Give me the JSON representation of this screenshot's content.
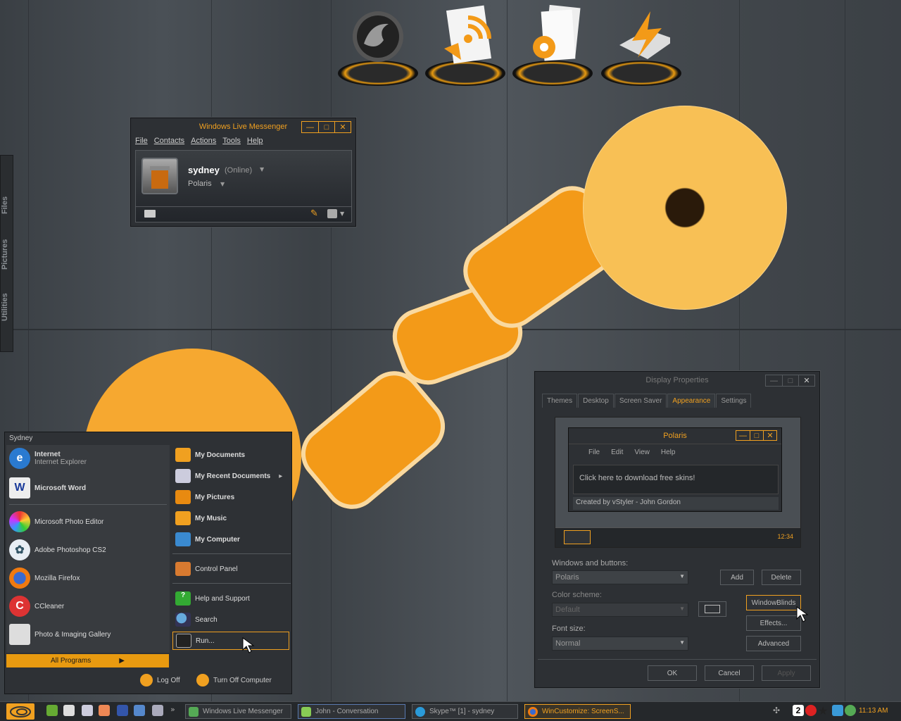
{
  "sidebar_tabs": [
    "Files",
    "Pictures",
    "Utilities"
  ],
  "dock": {
    "items": [
      "firefox-icon",
      "rss-icon",
      "document-settings-icon",
      "winamp-icon"
    ]
  },
  "messenger": {
    "title": "Windows Live Messenger",
    "menu": [
      "File",
      "Contacts",
      "Actions",
      "Tools",
      "Help"
    ],
    "username": "sydney",
    "status": "(Online)",
    "personal_message": "Polaris"
  },
  "start_menu": {
    "user": "Sydney",
    "pinned": [
      {
        "title": "Internet",
        "sub": "Internet Explorer"
      },
      {
        "title": "Microsoft Word",
        "sub": ""
      }
    ],
    "recent": [
      "Microsoft Photo Editor",
      "Adobe Photoshop CS2",
      "Mozilla Firefox",
      "CCleaner",
      "Photo & Imaging Gallery"
    ],
    "right": [
      "My Documents",
      "My Recent Documents",
      "My Pictures",
      "My Music",
      "My Computer",
      "Control Panel",
      "Help and Support",
      "Search",
      "Run..."
    ],
    "all_programs": "All Programs",
    "log_off": "Log Off",
    "turn_off": "Turn Off Computer"
  },
  "display": {
    "title": "Display Properties",
    "tabs": [
      "Themes",
      "Desktop",
      "Screen Saver",
      "Appearance",
      "Settings"
    ],
    "active_tab": "Appearance",
    "preview": {
      "title": "Polaris",
      "menu": [
        "File",
        "Edit",
        "View",
        "Help"
      ],
      "body": "Click here to download free skins!",
      "status": "Created by vStyler - John Gordon",
      "clock": "12:34"
    },
    "windows_buttons_label": "Windows and buttons:",
    "windows_buttons_value": "Polaris",
    "add": "Add",
    "delete": "Delete",
    "color_scheme_label": "Color scheme:",
    "color_scheme_value": "Default",
    "windowblinds": "WindowBlinds",
    "font_size_label": "Font size:",
    "font_size_value": "Normal",
    "effects": "Effects...",
    "advanced": "Advanced",
    "ok": "OK",
    "cancel": "Cancel",
    "apply": "Apply"
  },
  "taskbar": {
    "tasks": [
      "Windows Live Messenger",
      "John - Conversation",
      "Skype™ [1] - sydney",
      "WinCustomize: ScreenS..."
    ],
    "tray_badge": "2",
    "clock": "11:13 AM"
  },
  "colors": {
    "accent": "#f0a020",
    "panel": "#2d3034"
  }
}
